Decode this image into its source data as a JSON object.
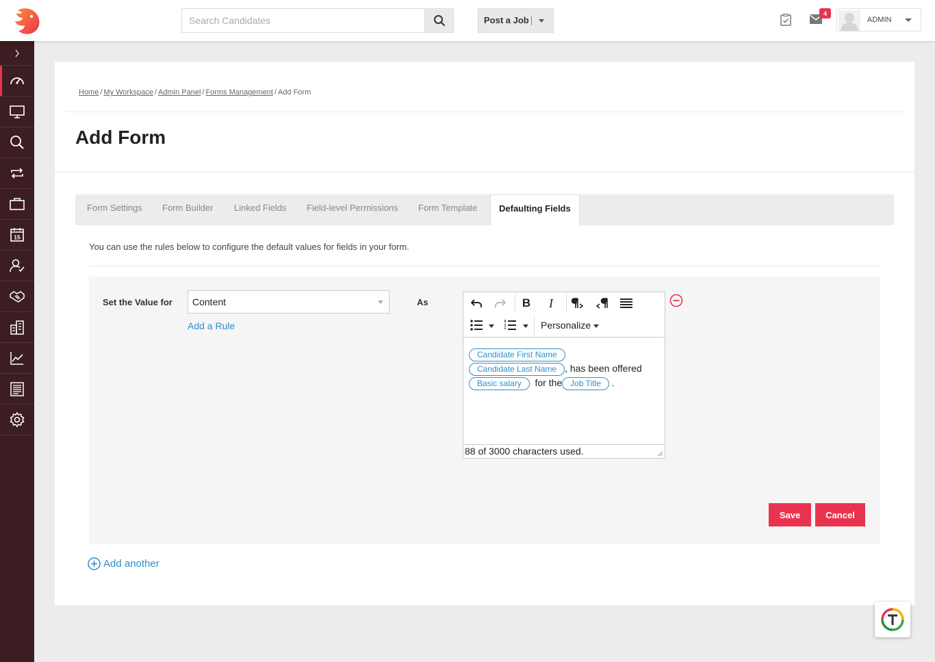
{
  "header": {
    "search_placeholder": "Search Candidates",
    "post_job_label": "Post a Job",
    "mail_count": "4",
    "user_name": "ADMIN"
  },
  "sidebar": {
    "items": [
      "dashboard-icon",
      "monitor-icon",
      "search-icon",
      "workflow-icon",
      "briefcase-icon",
      "calendar-icon",
      "candidates-icon",
      "handshake-icon",
      "buildings-icon",
      "analytics-icon",
      "reports-icon",
      "settings-icon"
    ],
    "calendar_day": "15",
    "accent": "#e8344e",
    "background": "#3b1d22"
  },
  "breadcrumb": {
    "items": [
      "Home",
      "My Workspace",
      "Admin Panel",
      "Forms Management"
    ],
    "current": "Add Form",
    "separator": "/"
  },
  "page_title": "Add Form",
  "tabs": [
    {
      "label": "Form Settings"
    },
    {
      "label": "Form Builder"
    },
    {
      "label": "Linked Fields"
    },
    {
      "label": "Field-level Permissions"
    },
    {
      "label": "Form Template"
    },
    {
      "label": "Defaulting Fields",
      "active": true
    }
  ],
  "intro_text": "You can use the rules below to configure the default values for fields in your form.",
  "rule": {
    "set_label": "Set the Value for",
    "field_value": "Content",
    "add_rule_label": "Add a Rule",
    "as_label": "As",
    "editor": {
      "personalize_label": "Personalize",
      "chip_first_name": "Candidate First Name",
      "chip_last_name": "Candidate Last Name",
      "text_offered": ", has been offered",
      "chip_salary": "Basic salary",
      "text_for_the": "for the",
      "chip_job_title": "Job Title",
      "text_period": ".",
      "char_count": "88 of 3000 characters used."
    }
  },
  "buttons": {
    "save": "Save",
    "cancel": "Cancel",
    "add_another": "Add another"
  },
  "colors": {
    "accent": "#e8344e",
    "link": "#2c8fc9"
  }
}
